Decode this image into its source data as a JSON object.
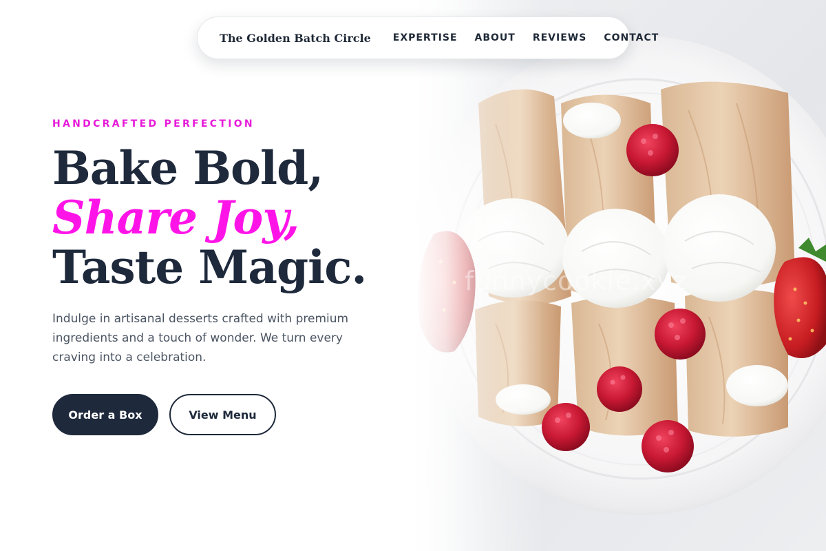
{
  "nav": {
    "brand": "The Golden Batch Circle",
    "links": [
      {
        "label": "EXPERTISE"
      },
      {
        "label": "ABOUT"
      },
      {
        "label": "REVIEWS"
      },
      {
        "label": "CONTACT"
      }
    ]
  },
  "hero": {
    "eyebrow": "HANDCRAFTED PERFECTION",
    "headline": {
      "line1": "Bake Bold,",
      "line2": "Share Joy,",
      "line3": "Taste Magic."
    },
    "description": "Indulge in artisanal desserts crafted with premium ingredients and a touch of wonder. We turn every craving into a celebration.",
    "primary_button": "Order a Box",
    "secondary_button": "View Menu",
    "watermark": "funnycookie.xyz"
  },
  "colors": {
    "accent": "#ff14e8",
    "eyebrow": "#e61ad9",
    "navy": "#1e293b",
    "body_text": "#4b5563"
  }
}
